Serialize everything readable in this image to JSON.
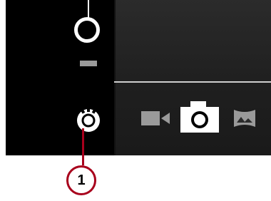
{
  "callout": {
    "number": "1",
    "color": "#a8001c"
  },
  "controls": {
    "shutter_icon": "shutter-ring-icon",
    "settings_icon": "settings-dial-icon"
  },
  "modes": [
    {
      "name": "video",
      "icon": "video-camera-icon"
    },
    {
      "name": "camera",
      "icon": "camera-icon"
    },
    {
      "name": "panorama",
      "icon": "panorama-icon"
    }
  ],
  "colors": {
    "background": "#000000",
    "panel_light": "#2b2b2b",
    "icon": "#ffffff",
    "icon_dim": "#9a9a9a",
    "accent": "#a8001c"
  }
}
